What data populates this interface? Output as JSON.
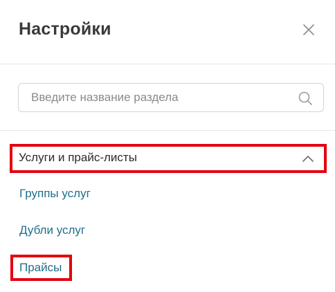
{
  "panel": {
    "title": "Настройки"
  },
  "search": {
    "placeholder": "Введите название раздела",
    "value": ""
  },
  "section": {
    "label": "Услуги и прайс-листы",
    "expanded": true,
    "items": [
      {
        "label": "Группы услуг"
      },
      {
        "label": "Дубли услуг"
      },
      {
        "label": "Прайсы"
      }
    ]
  },
  "icons": {
    "close": "close-icon",
    "search": "search-icon",
    "chevron": "chevron-up-icon"
  },
  "colors": {
    "link": "#1f6f8b",
    "highlight": "#e3000f",
    "title": "#3a3a3a"
  }
}
